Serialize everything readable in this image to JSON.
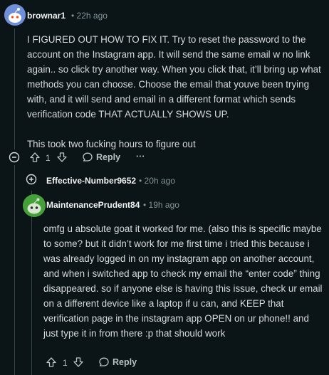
{
  "comment1": {
    "username": "brownar1",
    "time": "22h ago",
    "paragraph1": "I FIGURED OUT HOW TO FIX IT. Try to reset the password to the account on the Instagram app. It will send the same email w no link again.. so click try another way. When you click that, it’ll bring up what methods you can choose. Choose the email that youve been trying with, and it will send and email in a different format which sends verification code THAT ACTUALLY SHOWS UP.",
    "paragraph2": "This took two fucking hours to figure out",
    "votes": "1",
    "reply_label": "Reply",
    "more_label": "···"
  },
  "collapsed_reply": {
    "username": "Effective-Number9652",
    "time": "20h ago"
  },
  "comment2": {
    "username": "MaintenancePrudent84",
    "time": "19h ago",
    "body": "omfg u absolute goat it worked for me. (also this is specific maybe to some? but it didn’t work for me first time i tried this because i was already logged in on my instagram app on another account, and when i switched app to check my email the “enter code” thing disappeared. so if anyone else is having this issue, check ur email on a different device like a laptop if u can, and KEEP that verification page in the instagram app OPEN on ur phone!! and just type it in from there :p that should work",
    "votes": "1",
    "reply_label": "Reply"
  },
  "colors": {
    "background": "#0b1416",
    "text": "#d7dadc",
    "meta": "#82959b",
    "thread_line": "#33464c",
    "avatar1_bg": "#6f8fd8",
    "avatar2_bg": "#46a03a"
  }
}
